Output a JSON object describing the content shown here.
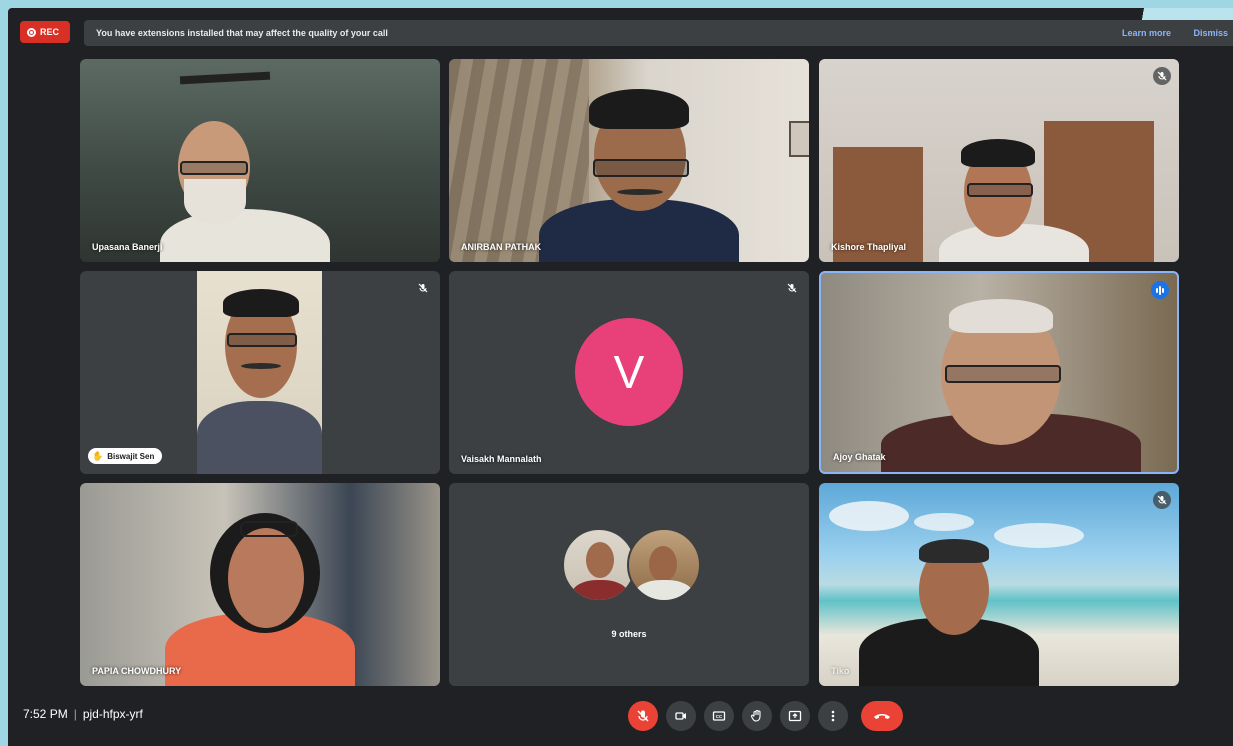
{
  "banner": {
    "rec_label": "REC",
    "message": "You have extensions installed that may affect the quality of your call",
    "learn_more": "Learn more",
    "dismiss": "Dismiss"
  },
  "participants": [
    {
      "name": "Upasana Banerji",
      "muted": false
    },
    {
      "name": "ANIRBAN PATHAK",
      "muted": false
    },
    {
      "name": "Kishore Thapliyal",
      "muted": true
    },
    {
      "name": "Biswajit Sen",
      "muted": true,
      "hand_raised": true
    },
    {
      "name": "Vaisakh Mannalath",
      "muted": true,
      "initial": "V"
    },
    {
      "name": "Ajoy Ghatak",
      "speaking": true
    },
    {
      "name": "PAPIA CHOWDHURY",
      "muted": false
    },
    {
      "name": "9 others",
      "is_group": true
    },
    {
      "name": "Tiko",
      "muted": true
    }
  ],
  "meeting": {
    "time": "7:52 PM",
    "code": "pjd-hfpx-yrf"
  },
  "controls": [
    "mic-off-icon",
    "camera-icon",
    "captions-icon",
    "raise-hand-icon",
    "present-icon",
    "more-icon",
    "end-call-icon"
  ],
  "colors": {
    "background": "#202124",
    "tile": "#3c4043",
    "accent_red": "#ea4335",
    "avatar_pink": "#e8417a",
    "speaking_blue": "#8ab4f8"
  }
}
